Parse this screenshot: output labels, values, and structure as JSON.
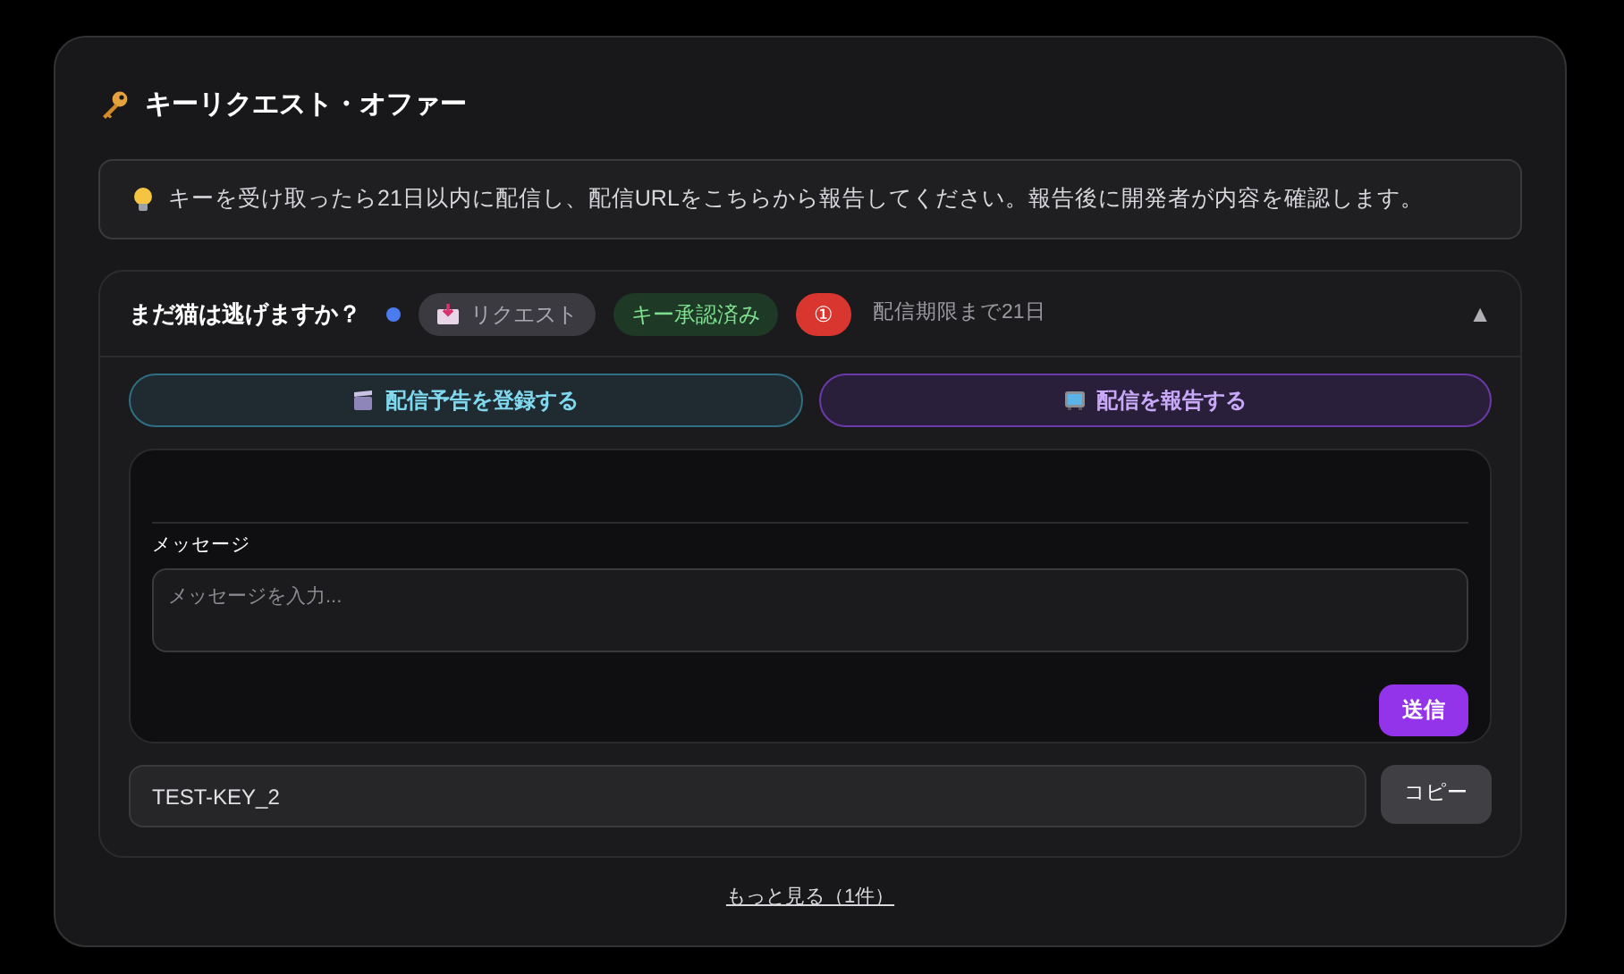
{
  "title": "キーリクエスト・オファー",
  "notice": "キーを受け取ったら21日以内に配信し、配信URLをこちらから報告してください。報告後に開発者が内容を確認します。",
  "offer": {
    "game_title": "まだ猫は逃げますか？",
    "unread": true,
    "expanded": true,
    "toggle": "▲",
    "badges": [
      {
        "kind": "request",
        "label": "リクエスト"
      },
      {
        "kind": "approved",
        "label": "キー承認済み"
      },
      {
        "kind": "count",
        "label": "①"
      }
    ],
    "deadline": "配信期限まで21日",
    "actions": [
      {
        "kind": "schedule",
        "label": "配信予告を登録する"
      },
      {
        "kind": "report",
        "label": "配信を報告する"
      }
    ],
    "message": {
      "label": "メッセージ",
      "placeholder": "メッセージを入力...",
      "send": "送信"
    },
    "key": {
      "value": "TEST-KEY_2",
      "copy": "コピー"
    }
  },
  "more_link": "もっと見る（1件）"
}
